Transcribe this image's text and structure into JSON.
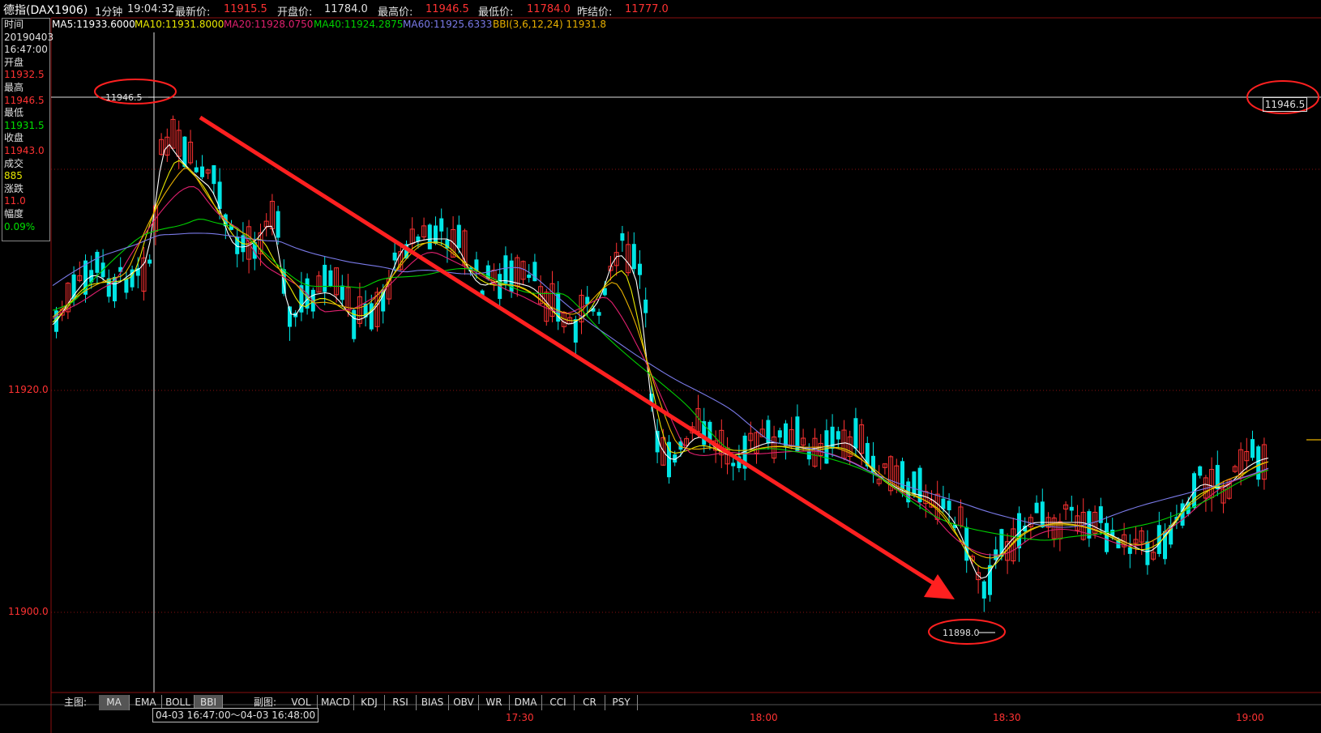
{
  "header": {
    "title": "德指(DAX1906)",
    "period": "1分钟",
    "time": "19:04:32",
    "latest_label": "最新价:",
    "latest_value": "11915.5",
    "open_label": "开盘价:",
    "open_value": "11784.0",
    "high_label": "最高价:",
    "high_value": "11946.5",
    "low_label": "最低价:",
    "low_value": "11784.0",
    "prev_label": "昨结价:",
    "prev_value": "11777.0"
  },
  "ma_legend": {
    "ma5": "MA5:11933.6000",
    "ma10": "MA10:11931.8000",
    "ma20": "MA20:11928.0750",
    "ma40": "MA40:11924.2875",
    "ma60": "MA60:11925.6333",
    "bbi": "BBI(3,6,12,24) 11931.8"
  },
  "info_panel": {
    "time_label": "时间",
    "date": "20190403",
    "time": "16:47:00",
    "open_label": "开盘",
    "open": "11932.5",
    "high_label": "最高",
    "high": "11946.5",
    "low_label": "最低",
    "low": "11931.5",
    "close_label": "收盘",
    "close": "11943.0",
    "volume_label": "成交",
    "volume": "885",
    "change_label": "涨跌",
    "change": "11.0",
    "amplitude_label": "幅度",
    "amplitude": "0.09%"
  },
  "y_axis": {
    "labels": [
      "11920.0",
      "11900.0"
    ]
  },
  "annotations": {
    "high_marker": "11946.5",
    "right_price": "11946.5",
    "low_marker": "11898.0"
  },
  "tabs": {
    "main_label": "主图:",
    "main": [
      "MA",
      "EMA",
      "BOLL",
      "BBI"
    ],
    "sub_label": "副图:",
    "sub": [
      "VOL",
      "MACD",
      "KDJ",
      "RSI",
      "BIAS",
      "OBV",
      "WR",
      "DMA",
      "CCI",
      "CR",
      "PSY"
    ]
  },
  "x_axis": {
    "range": "04-03  16:47:00〜04-03 16:48:00",
    "labels": [
      "17:30",
      "18:00",
      "18:30",
      "19:00"
    ]
  },
  "colors": {
    "up": "#ff3232",
    "down": "#00e5e5",
    "ma5": "#ffffff",
    "ma10": "#e8e800",
    "ma20": "#e0206e",
    "ma40": "#00d000",
    "ma60": "#7a7ae8",
    "bbi": "#e8b000",
    "trend_arrow": "#ff2020"
  }
}
